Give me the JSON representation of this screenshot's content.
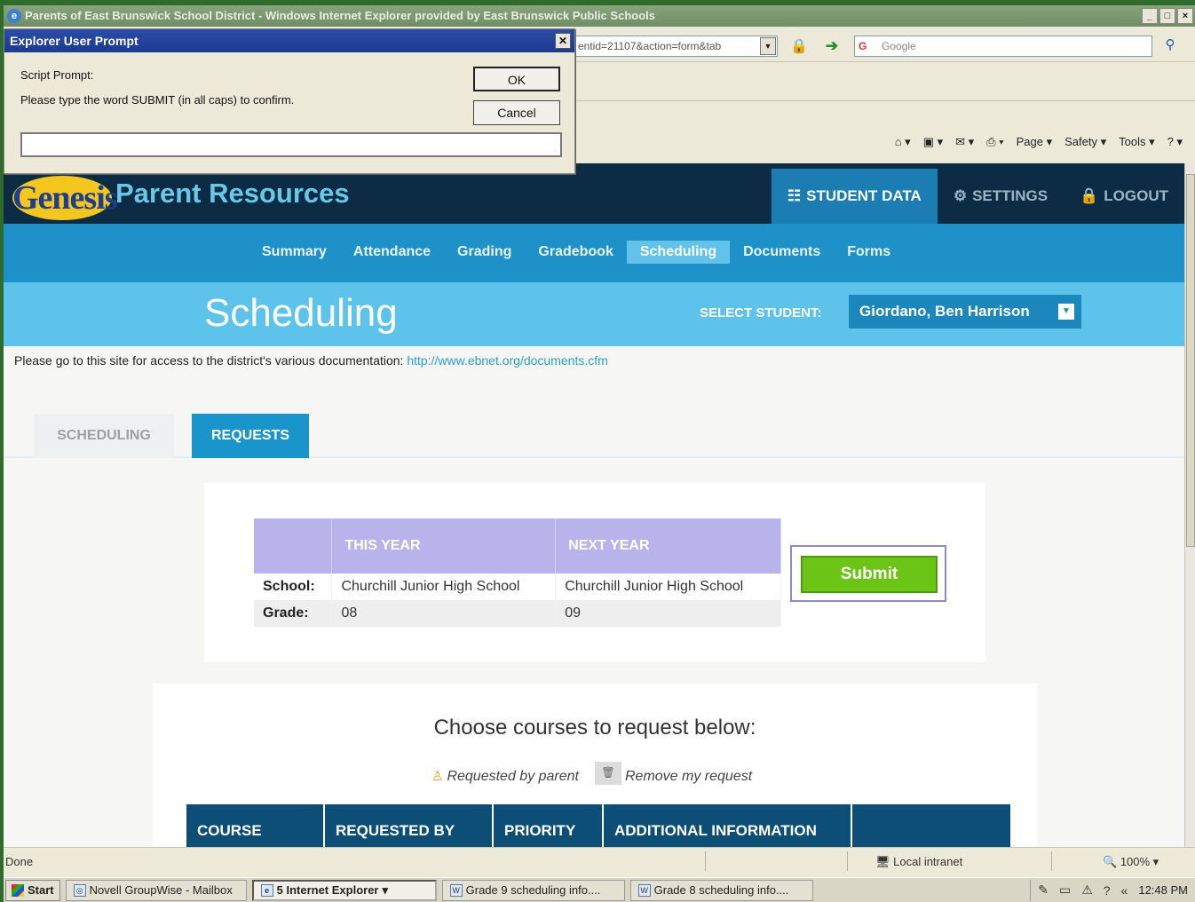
{
  "window": {
    "title": "Parents of East Brunswick School District - Windows Internet Explorer provided by East Brunswick Public Schools",
    "controls": [
      "_",
      "□",
      "×"
    ]
  },
  "addressbar": {
    "url_fragment": "entid=21107&action=form&tab",
    "search_placeholder": "Google"
  },
  "commandbar": {
    "items": [
      "Page ▾",
      "Safety ▾",
      "Tools ▾",
      "? ▾"
    ]
  },
  "dialog": {
    "title": "Explorer User Prompt",
    "line1": "Script Prompt:",
    "line2": "Please type the word SUBMIT (in all caps) to confirm.",
    "ok_label": "OK",
    "cancel_label": "Cancel",
    "input_value": ""
  },
  "header": {
    "logo_text": "Genesis",
    "app_title": "Parent Resources",
    "nav": [
      {
        "label": "STUDENT DATA",
        "icon": "☷"
      },
      {
        "label": "SETTINGS",
        "icon": "⚙"
      },
      {
        "label": "LOGOUT",
        "icon": "🔒"
      }
    ]
  },
  "subnav": {
    "items": [
      "Summary",
      "Attendance",
      "Grading",
      "Gradebook",
      "Scheduling",
      "Documents",
      "Forms"
    ],
    "active": "Scheduling"
  },
  "band": {
    "page_title": "Scheduling",
    "select_label": "SELECT STUDENT:",
    "selected_student": "Giordano, Ben Harrison"
  },
  "docline": {
    "text": "Please go to this site for access to the district's various documentation:",
    "link": "http://www.ebnet.org/documents.cfm"
  },
  "tabs": {
    "scheduling": "SCHEDULING",
    "requests": "REQUESTS"
  },
  "year_table": {
    "headers": [
      "",
      "THIS YEAR",
      "NEXT YEAR"
    ],
    "rows": [
      {
        "label": "School:",
        "this_year": "Churchill Junior High School",
        "next_year": "Churchill Junior High School"
      },
      {
        "label": "Grade:",
        "this_year": "08",
        "next_year": "09"
      }
    ]
  },
  "submit_label": "Submit",
  "courses": {
    "heading": "Choose courses to request below:",
    "legend_requested": "Requested by parent",
    "legend_remove": "Remove my request",
    "columns": [
      "COURSE",
      "REQUESTED BY",
      "PRIORITY",
      "ADDITIONAL INFORMATION",
      ""
    ]
  },
  "statusbar": {
    "status": "Done",
    "zone": "Local intranet",
    "zoom": "100%"
  },
  "taskbar": {
    "start": "Start",
    "tasks": [
      "Novell GroupWise - Mailbox",
      "5 Internet Explorer",
      "Grade 9 scheduling info....",
      "Grade 8 scheduling info...."
    ],
    "clock": "12:48 PM"
  },
  "colors": {
    "header_bg": "#0b2c44",
    "subnav_bg": "#1e92c8",
    "band_bg": "#5ec3eb",
    "submit_green": "#6cc417",
    "table_header": "#b9b3ec"
  }
}
